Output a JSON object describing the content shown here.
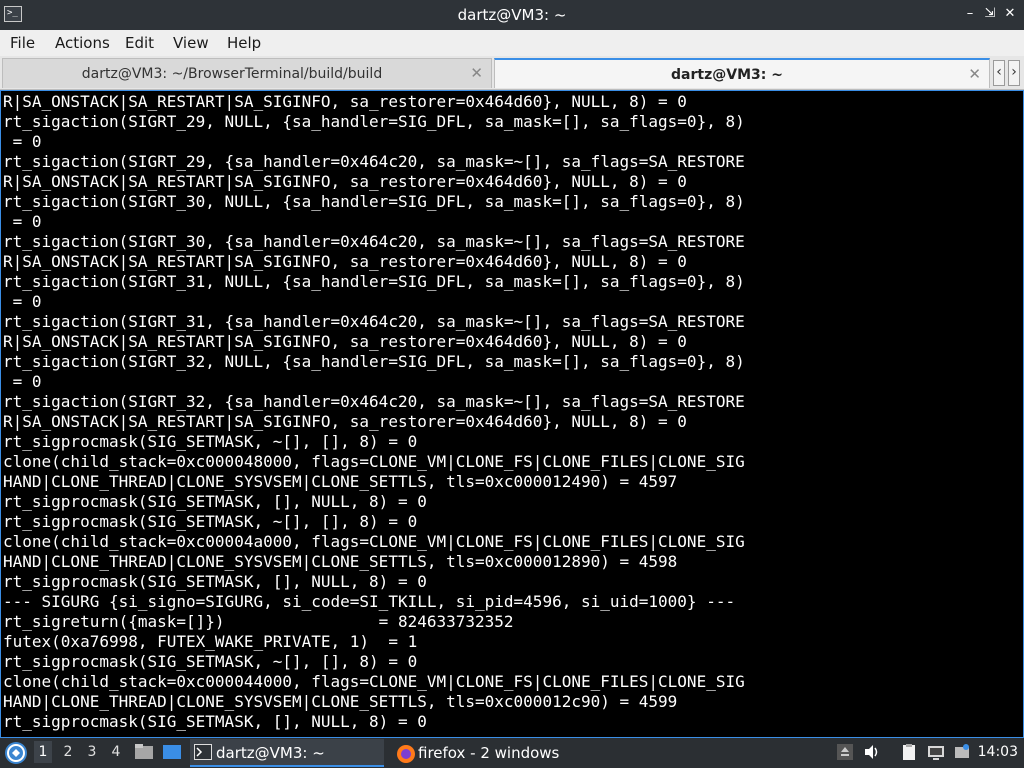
{
  "window": {
    "title": "dartz@VM3: ~"
  },
  "menu": {
    "file": "File",
    "actions": "Actions",
    "edit": "Edit",
    "view": "View",
    "help": "Help"
  },
  "tabs": [
    {
      "label": "dartz@VM3: ~/BrowserTerminal/build/build",
      "active": false
    },
    {
      "label": "dartz@VM3: ~",
      "active": true
    }
  ],
  "terminal": {
    "lines": [
      "R|SA_ONSTACK|SA_RESTART|SA_SIGINFO, sa_restorer=0x464d60}, NULL, 8) = 0",
      "rt_sigaction(SIGRT_29, NULL, {sa_handler=SIG_DFL, sa_mask=[], sa_flags=0}, 8)",
      " = 0",
      "rt_sigaction(SIGRT_29, {sa_handler=0x464c20, sa_mask=~[], sa_flags=SA_RESTORE",
      "R|SA_ONSTACK|SA_RESTART|SA_SIGINFO, sa_restorer=0x464d60}, NULL, 8) = 0",
      "rt_sigaction(SIGRT_30, NULL, {sa_handler=SIG_DFL, sa_mask=[], sa_flags=0}, 8)",
      " = 0",
      "rt_sigaction(SIGRT_30, {sa_handler=0x464c20, sa_mask=~[], sa_flags=SA_RESTORE",
      "R|SA_ONSTACK|SA_RESTART|SA_SIGINFO, sa_restorer=0x464d60}, NULL, 8) = 0",
      "rt_sigaction(SIGRT_31, NULL, {sa_handler=SIG_DFL, sa_mask=[], sa_flags=0}, 8)",
      " = 0",
      "rt_sigaction(SIGRT_31, {sa_handler=0x464c20, sa_mask=~[], sa_flags=SA_RESTORE",
      "R|SA_ONSTACK|SA_RESTART|SA_SIGINFO, sa_restorer=0x464d60}, NULL, 8) = 0",
      "rt_sigaction(SIGRT_32, NULL, {sa_handler=SIG_DFL, sa_mask=[], sa_flags=0}, 8)",
      " = 0",
      "rt_sigaction(SIGRT_32, {sa_handler=0x464c20, sa_mask=~[], sa_flags=SA_RESTORE",
      "R|SA_ONSTACK|SA_RESTART|SA_SIGINFO, sa_restorer=0x464d60}, NULL, 8) = 0",
      "rt_sigprocmask(SIG_SETMASK, ~[], [], 8) = 0",
      "clone(child_stack=0xc000048000, flags=CLONE_VM|CLONE_FS|CLONE_FILES|CLONE_SIG",
      "HAND|CLONE_THREAD|CLONE_SYSVSEM|CLONE_SETTLS, tls=0xc000012490) = 4597",
      "rt_sigprocmask(SIG_SETMASK, [], NULL, 8) = 0",
      "rt_sigprocmask(SIG_SETMASK, ~[], [], 8) = 0",
      "clone(child_stack=0xc00004a000, flags=CLONE_VM|CLONE_FS|CLONE_FILES|CLONE_SIG",
      "HAND|CLONE_THREAD|CLONE_SYSVSEM|CLONE_SETTLS, tls=0xc000012890) = 4598",
      "rt_sigprocmask(SIG_SETMASK, [], NULL, 8) = 0",
      "--- SIGURG {si_signo=SIGURG, si_code=SI_TKILL, si_pid=4596, si_uid=1000} ---",
      "rt_sigreturn({mask=[]})                = 824633732352",
      "futex(0xa76998, FUTEX_WAKE_PRIVATE, 1)  = 1",
      "rt_sigprocmask(SIG_SETMASK, ~[], [], 8) = 0",
      "clone(child_stack=0xc000044000, flags=CLONE_VM|CLONE_FS|CLONE_FILES|CLONE_SIG",
      "HAND|CLONE_THREAD|CLONE_SYSVSEM|CLONE_SETTLS, tls=0xc000012c90) = 4599",
      "rt_sigprocmask(SIG_SETMASK, [], NULL, 8) = 0"
    ]
  },
  "taskbar": {
    "workspaces": [
      "1",
      "2",
      "3",
      "4"
    ],
    "active_workspace": "1",
    "items": [
      {
        "label": "dartz@VM3: ~",
        "icon": "terminal-icon",
        "active": true
      },
      {
        "label": "firefox - 2 windows",
        "icon": "firefox-icon",
        "active": false
      }
    ],
    "clock": "14:03"
  },
  "colors": {
    "accent": "#3a8ee6",
    "terminal_bg": "#000000",
    "terminal_fg": "#ffffff",
    "titlebar_bg": "#2e3338",
    "taskbar_bg": "#2b2f33"
  },
  "icons": {
    "app": "terminal-app-icon",
    "minimize": "minimize-icon",
    "maximize": "maximize-icon",
    "close": "close-icon",
    "start": "start-menu-icon",
    "tray": [
      "upload-icon",
      "volume-icon",
      "clipboard-icon",
      "network-icon"
    ]
  }
}
